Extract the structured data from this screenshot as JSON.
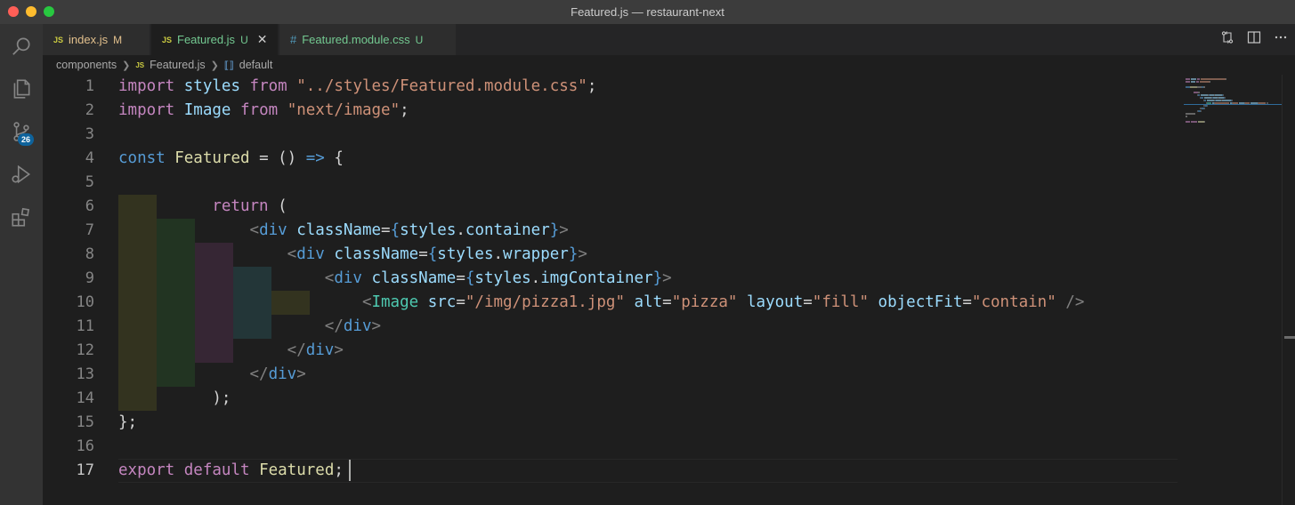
{
  "window": {
    "title": "Featured.js — restaurant-next"
  },
  "activity_bar": {
    "items": [
      {
        "icon": "files-icon"
      },
      {
        "icon": "search-icon"
      },
      {
        "icon": "source-control-icon",
        "badge": "26"
      },
      {
        "icon": "run-debug-icon"
      },
      {
        "icon": "extensions-icon"
      }
    ]
  },
  "tabs": [
    {
      "icon": "JS",
      "label": "index.js",
      "status": "M",
      "active": false
    },
    {
      "icon": "JS",
      "label": "Featured.js",
      "status": "U",
      "active": true
    },
    {
      "icon": "#",
      "label": "Featured.module.css",
      "status": "U",
      "active": false
    }
  ],
  "breadcrumbs": {
    "folder": "components",
    "file_icon": "JS",
    "file": "Featured.js",
    "symbol": "default"
  },
  "editor": {
    "line_numbers": [
      "1",
      "2",
      "3",
      "4",
      "5",
      "6",
      "7",
      "8",
      "9",
      "10",
      "11",
      "12",
      "13",
      "14",
      "15",
      "16",
      "17"
    ],
    "current_line": "17",
    "lines": [
      [
        [
          "kw2",
          "import"
        ],
        [
          "plain",
          " "
        ],
        [
          "var",
          "styles"
        ],
        [
          "plain",
          " "
        ],
        [
          "kw2",
          "from"
        ],
        [
          "plain",
          " "
        ],
        [
          "str",
          "\"../styles/Featured.module.css\""
        ],
        [
          "plain",
          ";"
        ]
      ],
      [
        [
          "kw2",
          "import"
        ],
        [
          "plain",
          " "
        ],
        [
          "var",
          "Image"
        ],
        [
          "plain",
          " "
        ],
        [
          "kw2",
          "from"
        ],
        [
          "plain",
          " "
        ],
        [
          "str",
          "\"next/image\""
        ],
        [
          "plain",
          ";"
        ]
      ],
      [],
      [
        [
          "kw",
          "const"
        ],
        [
          "plain",
          " "
        ],
        [
          "fn",
          "Featured"
        ],
        [
          "plain",
          " = () "
        ],
        [
          "kw",
          "=>"
        ],
        [
          "plain",
          " {"
        ]
      ],
      [],
      [
        [
          "plain",
          "          "
        ],
        [
          "kw2",
          "return"
        ],
        [
          "plain",
          " ("
        ]
      ],
      [
        [
          "plain",
          "              "
        ],
        [
          "punc",
          "<"
        ],
        [
          "tag",
          "div"
        ],
        [
          "plain",
          " "
        ],
        [
          "attr",
          "className"
        ],
        [
          "plain",
          "="
        ],
        [
          "kw",
          "{"
        ],
        [
          "var",
          "styles"
        ],
        [
          "plain",
          "."
        ],
        [
          "var",
          "container"
        ],
        [
          "kw",
          "}"
        ],
        [
          "punc",
          ">"
        ]
      ],
      [
        [
          "plain",
          "                  "
        ],
        [
          "punc",
          "<"
        ],
        [
          "tag",
          "div"
        ],
        [
          "plain",
          " "
        ],
        [
          "attr",
          "className"
        ],
        [
          "plain",
          "="
        ],
        [
          "kw",
          "{"
        ],
        [
          "var",
          "styles"
        ],
        [
          "plain",
          "."
        ],
        [
          "var",
          "wrapper"
        ],
        [
          "kw",
          "}"
        ],
        [
          "punc",
          ">"
        ]
      ],
      [
        [
          "plain",
          "                      "
        ],
        [
          "punc",
          "<"
        ],
        [
          "tag",
          "div"
        ],
        [
          "plain",
          " "
        ],
        [
          "attr",
          "className"
        ],
        [
          "plain",
          "="
        ],
        [
          "kw",
          "{"
        ],
        [
          "var",
          "styles"
        ],
        [
          "plain",
          "."
        ],
        [
          "var",
          "imgContainer"
        ],
        [
          "kw",
          "}"
        ],
        [
          "punc",
          ">"
        ]
      ],
      [
        [
          "plain",
          "                          "
        ],
        [
          "punc",
          "<"
        ],
        [
          "tagc",
          "Image"
        ],
        [
          "plain",
          " "
        ],
        [
          "attr",
          "src"
        ],
        [
          "plain",
          "="
        ],
        [
          "str",
          "\"/img/pizza1.jpg\""
        ],
        [
          "plain",
          " "
        ],
        [
          "attr",
          "alt"
        ],
        [
          "plain",
          "="
        ],
        [
          "str",
          "\"pizza\""
        ],
        [
          "plain",
          " "
        ],
        [
          "attr",
          "layout"
        ],
        [
          "plain",
          "="
        ],
        [
          "str",
          "\"fill\""
        ],
        [
          "plain",
          " "
        ],
        [
          "attr",
          "objectFit"
        ],
        [
          "plain",
          "="
        ],
        [
          "str",
          "\"contain\""
        ],
        [
          "plain",
          " "
        ],
        [
          "punc",
          "/>"
        ]
      ],
      [
        [
          "plain",
          "                      "
        ],
        [
          "punc",
          "</"
        ],
        [
          "tag",
          "div"
        ],
        [
          "punc",
          ">"
        ]
      ],
      [
        [
          "plain",
          "                  "
        ],
        [
          "punc",
          "</"
        ],
        [
          "tag",
          "div"
        ],
        [
          "punc",
          ">"
        ]
      ],
      [
        [
          "plain",
          "              "
        ],
        [
          "punc",
          "</"
        ],
        [
          "tag",
          "div"
        ],
        [
          "punc",
          ">"
        ]
      ],
      [
        [
          "plain",
          "          );"
        ]
      ],
      [
        [
          "plain",
          "};"
        ]
      ],
      [],
      [
        [
          "kw2",
          "export"
        ],
        [
          "plain",
          " "
        ],
        [
          "kw2",
          "default"
        ],
        [
          "plain",
          " "
        ],
        [
          "fn",
          "Featured"
        ],
        [
          "plain",
          ";"
        ]
      ]
    ]
  },
  "colors": {
    "keyword": "#569cd6",
    "control_keyword": "#c586c0",
    "string": "#ce9178",
    "function": "#dcdcaa",
    "variable": "#9cdcfe",
    "component": "#4ec9b0",
    "modified": "#e2c08d",
    "untracked": "#73c991",
    "badge": "#0e639c"
  }
}
